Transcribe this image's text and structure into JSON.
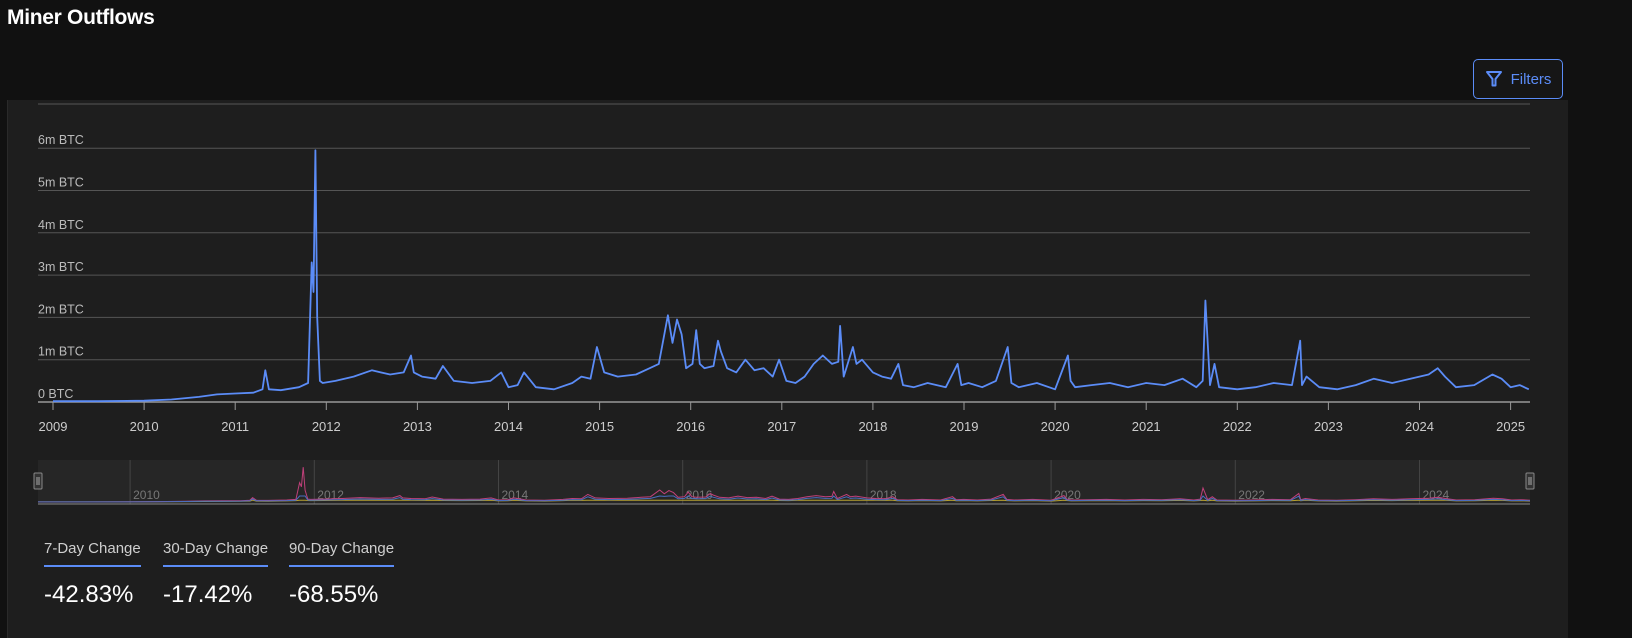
{
  "header": {
    "title": "Miner Outflows",
    "filters_label": "Filters",
    "filters_icon": "filter-icon"
  },
  "colors": {
    "accent": "#5b8cf7",
    "line": "#5b8cf7",
    "nav_pink": "#c0407a",
    "nav_gold": "#b5a030"
  },
  "chart_data": {
    "type": "line",
    "title": "Miner Outflows",
    "xlabel": "",
    "ylabel": "",
    "ylim": [
      0,
      6.6
    ],
    "xlim": [
      2009,
      2025.2
    ],
    "y_ticks": [
      {
        "v": 0,
        "label": "0 BTC"
      },
      {
        "v": 1,
        "label": "1m BTC"
      },
      {
        "v": 2,
        "label": "2m BTC"
      },
      {
        "v": 3,
        "label": "3m BTC"
      },
      {
        "v": 4,
        "label": "4m BTC"
      },
      {
        "v": 5,
        "label": "5m BTC"
      },
      {
        "v": 6,
        "label": "6m BTC"
      }
    ],
    "x_ticks": [
      "2009",
      "2010",
      "2011",
      "2012",
      "2013",
      "2014",
      "2015",
      "2016",
      "2017",
      "2018",
      "2019",
      "2020",
      "2021",
      "2022",
      "2023",
      "2024",
      "2025"
    ],
    "navigator_ticks": [
      "2010",
      "2012",
      "2014",
      "2016",
      "2018",
      "2020",
      "2022",
      "2024"
    ],
    "grid": true,
    "series": [
      {
        "name": "Miner Outflows (m BTC)",
        "x": [
          2009,
          2009.5,
          2010,
          2010.3,
          2010.6,
          2010.8,
          2011,
          2011.2,
          2011.3,
          2011.33,
          2011.37,
          2011.5,
          2011.7,
          2011.8,
          2011.84,
          2011.86,
          2011.88,
          2011.9,
          2011.93,
          2011.96,
          2012.1,
          2012.3,
          2012.5,
          2012.7,
          2012.85,
          2012.93,
          2012.96,
          2013.05,
          2013.2,
          2013.28,
          2013.4,
          2013.6,
          2013.8,
          2013.92,
          2014.0,
          2014.1,
          2014.17,
          2014.3,
          2014.5,
          2014.7,
          2014.8,
          2014.9,
          2014.97,
          2015.05,
          2015.2,
          2015.4,
          2015.55,
          2015.65,
          2015.75,
          2015.8,
          2015.85,
          2015.9,
          2015.95,
          2016.02,
          2016.06,
          2016.1,
          2016.15,
          2016.25,
          2016.3,
          2016.33,
          2016.4,
          2016.5,
          2016.6,
          2016.7,
          2016.8,
          2016.9,
          2016.97,
          2017.05,
          2017.15,
          2017.25,
          2017.35,
          2017.45,
          2017.55,
          2017.62,
          2017.64,
          2017.68,
          2017.78,
          2017.82,
          2017.88,
          2018.0,
          2018.1,
          2018.2,
          2018.28,
          2018.33,
          2018.45,
          2018.6,
          2018.8,
          2018.93,
          2018.97,
          2019.05,
          2019.2,
          2019.35,
          2019.48,
          2019.52,
          2019.6,
          2019.8,
          2020.0,
          2020.14,
          2020.17,
          2020.22,
          2020.4,
          2020.6,
          2020.8,
          2021.0,
          2021.2,
          2021.4,
          2021.55,
          2021.62,
          2021.65,
          2021.7,
          2021.75,
          2021.8,
          2022.0,
          2022.2,
          2022.4,
          2022.6,
          2022.69,
          2022.71,
          2022.76,
          2022.9,
          2023.1,
          2023.3,
          2023.5,
          2023.7,
          2023.9,
          2024.1,
          2024.2,
          2024.28,
          2024.4,
          2024.6,
          2024.8,
          2024.9,
          2025.0,
          2025.1,
          2025.2
        ],
        "values": [
          0.02,
          0.02,
          0.03,
          0.06,
          0.12,
          0.18,
          0.2,
          0.22,
          0.3,
          0.75,
          0.3,
          0.28,
          0.35,
          0.45,
          3.3,
          2.6,
          5.95,
          2.0,
          0.5,
          0.45,
          0.5,
          0.6,
          0.75,
          0.65,
          0.7,
          1.1,
          0.7,
          0.6,
          0.55,
          0.85,
          0.5,
          0.45,
          0.5,
          0.7,
          0.35,
          0.4,
          0.7,
          0.35,
          0.3,
          0.45,
          0.6,
          0.55,
          1.3,
          0.7,
          0.6,
          0.65,
          0.8,
          0.9,
          2.05,
          1.4,
          1.95,
          1.6,
          0.8,
          0.9,
          1.7,
          0.9,
          0.8,
          0.85,
          1.45,
          1.2,
          0.8,
          0.7,
          1.0,
          0.75,
          0.8,
          0.6,
          1.0,
          0.5,
          0.45,
          0.6,
          0.9,
          1.1,
          0.9,
          0.95,
          1.8,
          0.6,
          1.3,
          0.9,
          1.0,
          0.7,
          0.6,
          0.55,
          0.9,
          0.4,
          0.35,
          0.45,
          0.35,
          0.9,
          0.4,
          0.45,
          0.35,
          0.5,
          1.3,
          0.45,
          0.35,
          0.45,
          0.3,
          1.1,
          0.5,
          0.35,
          0.4,
          0.45,
          0.35,
          0.45,
          0.4,
          0.55,
          0.35,
          0.5,
          2.4,
          0.4,
          0.9,
          0.35,
          0.3,
          0.35,
          0.45,
          0.4,
          1.45,
          0.4,
          0.6,
          0.35,
          0.3,
          0.4,
          0.55,
          0.45,
          0.55,
          0.65,
          0.8,
          0.6,
          0.35,
          0.4,
          0.65,
          0.55,
          0.35,
          0.4,
          0.3
        ]
      }
    ]
  },
  "stats": [
    {
      "label": "7-Day Change",
      "value": "-42.83%"
    },
    {
      "label": "30-Day Change",
      "value": "-17.42%"
    },
    {
      "label": "90-Day Change",
      "value": "-68.55%"
    }
  ]
}
